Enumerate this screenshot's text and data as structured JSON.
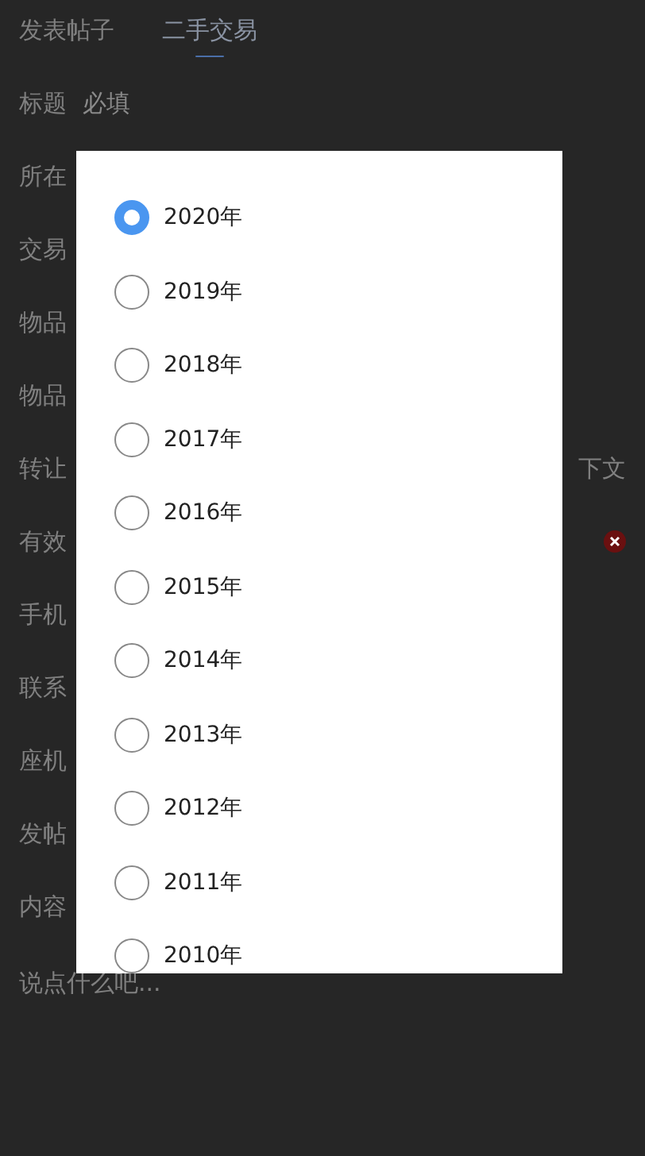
{
  "tabs": [
    {
      "label": "发表帖子",
      "selected": false
    },
    {
      "label": "二手交易",
      "selected": true
    }
  ],
  "form": {
    "rows": [
      {
        "label": "标题",
        "value": "必填"
      },
      {
        "label": "所在"
      },
      {
        "label": "交易"
      },
      {
        "label": "物品"
      },
      {
        "label": "物品"
      },
      {
        "label": "转让",
        "trailing": "下文"
      },
      {
        "label": "有效",
        "clear_icon": true
      },
      {
        "label": "手机"
      },
      {
        "label": "联系"
      },
      {
        "label": "座机"
      },
      {
        "label": "发帖"
      },
      {
        "label": "内容"
      }
    ],
    "content": {
      "placeholder": "说点什么吧..."
    }
  },
  "dialog": {
    "options": [
      {
        "label": "2020年",
        "selected": true
      },
      {
        "label": "2019年",
        "selected": false
      },
      {
        "label": "2018年",
        "selected": false
      },
      {
        "label": "2017年",
        "selected": false
      },
      {
        "label": "2016年",
        "selected": false
      },
      {
        "label": "2015年",
        "selected": false
      },
      {
        "label": "2014年",
        "selected": false
      },
      {
        "label": "2013年",
        "selected": false
      },
      {
        "label": "2012年",
        "selected": false
      },
      {
        "label": "2011年",
        "selected": false
      },
      {
        "label": "2010年",
        "selected": false
      }
    ]
  }
}
